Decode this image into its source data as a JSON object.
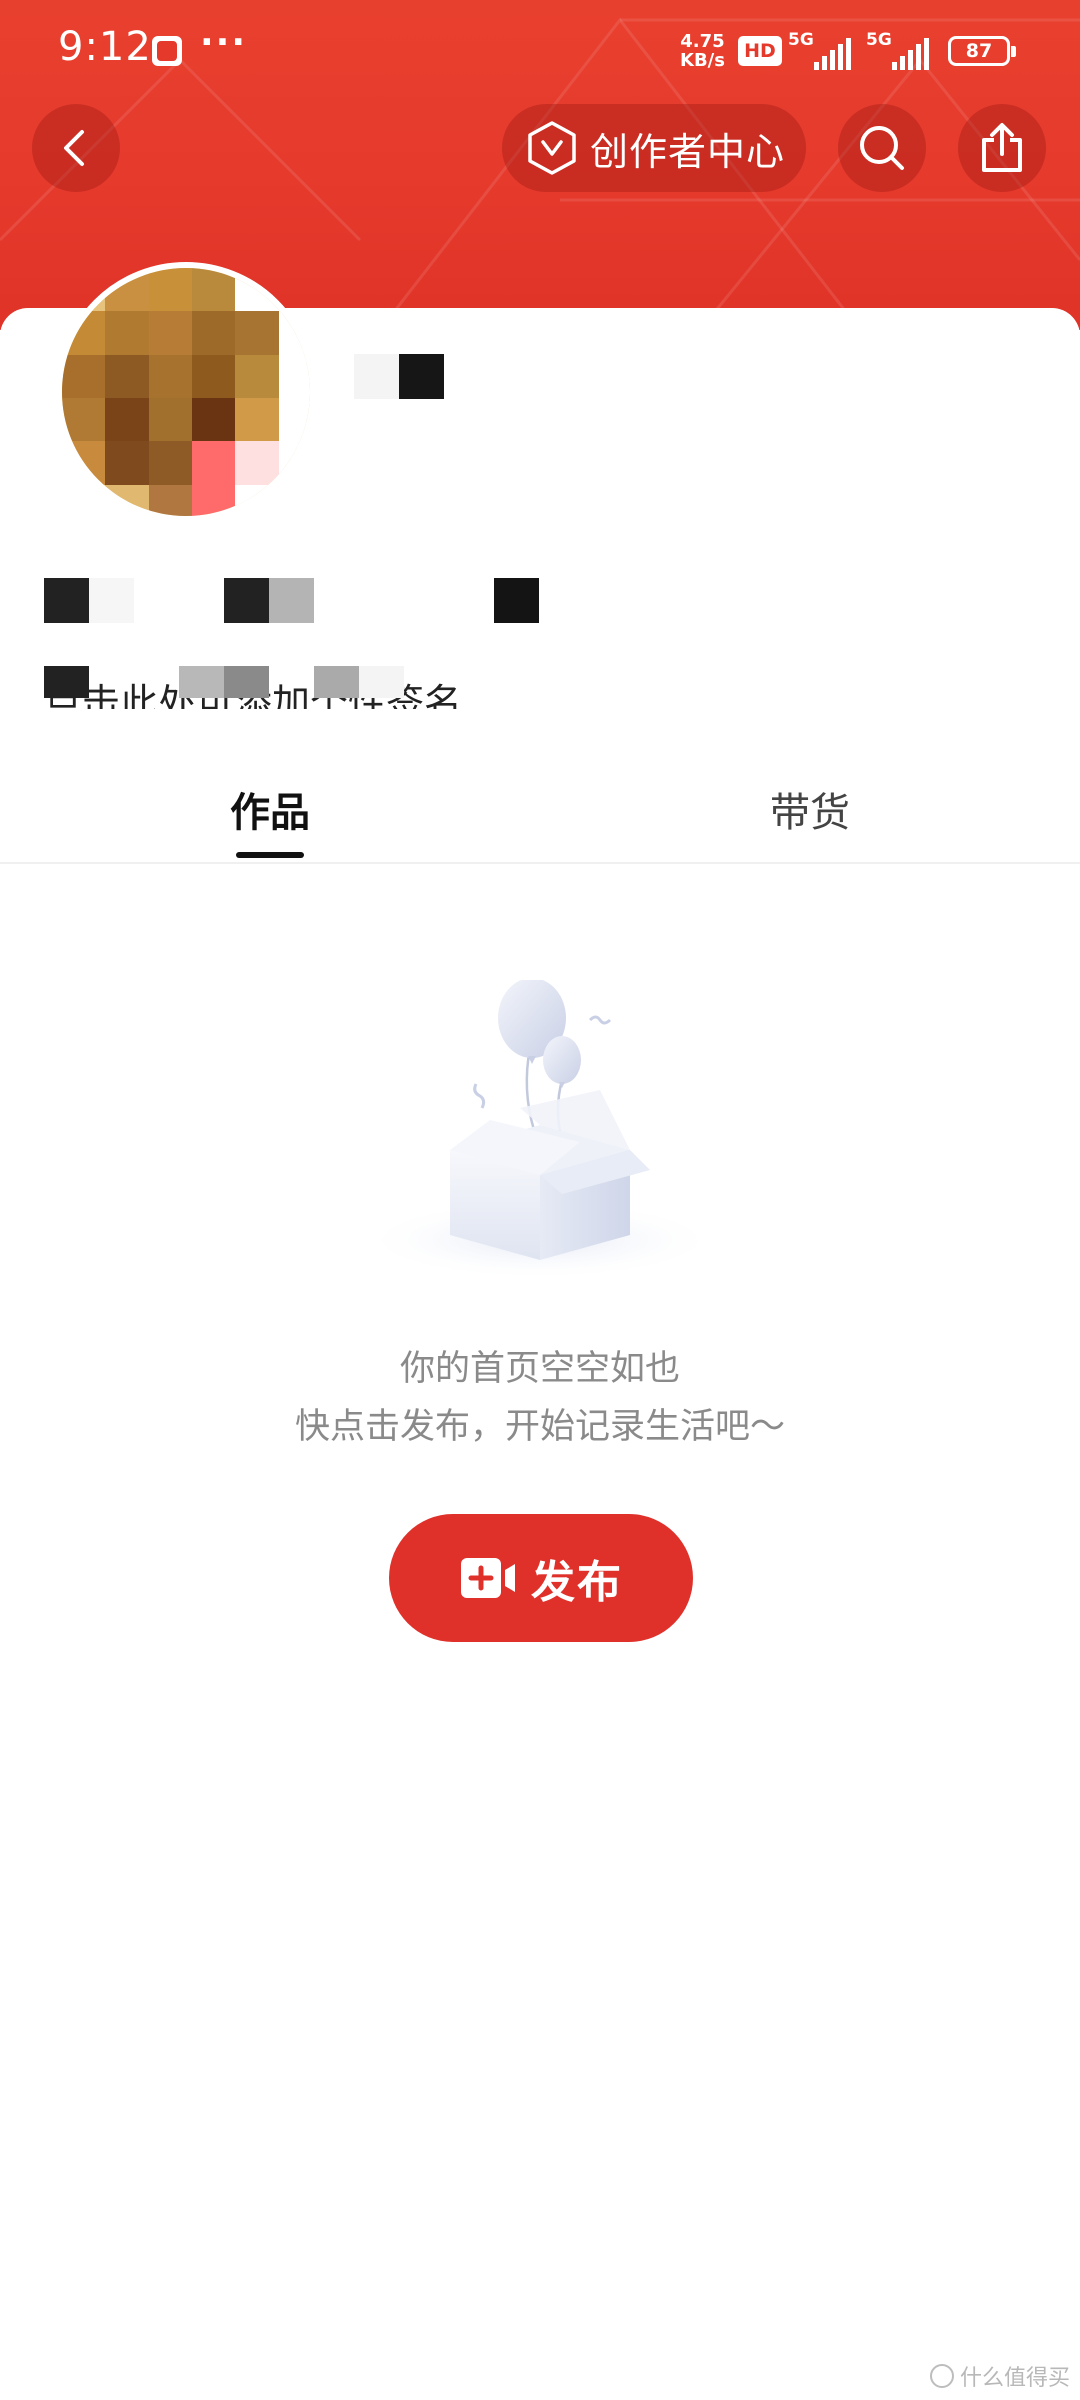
{
  "status_bar": {
    "time": "9:12",
    "more_dots": "···",
    "net_speed_value": "4.75",
    "net_speed_unit": "KB/s",
    "hd_label": "HD",
    "sim1_label": "5G",
    "sim2_label": "5G",
    "battery_level": "87"
  },
  "nav": {
    "creator_center_label": "创作者中心"
  },
  "profile": {
    "bio_hint": "点击此处可添加个性签名"
  },
  "tabs": {
    "works": "作品",
    "goods": "带货"
  },
  "empty_state": {
    "line1": "你的首页空空如也",
    "line2": "快点击发布，开始记录生活吧～"
  },
  "publish": {
    "label": "发布"
  },
  "watermark": {
    "text": "什么值得买"
  },
  "colors": {
    "brand_red": "#e5392c",
    "publish_red": "#e0302a",
    "muted_text": "#8a8a8a"
  },
  "icons": {
    "back": "chevron-left-icon",
    "creator": "hexagon-v-icon",
    "search": "search-icon",
    "share": "share-icon",
    "publish": "video-plus-icon",
    "empty": "gift-box-balloons-icon"
  }
}
